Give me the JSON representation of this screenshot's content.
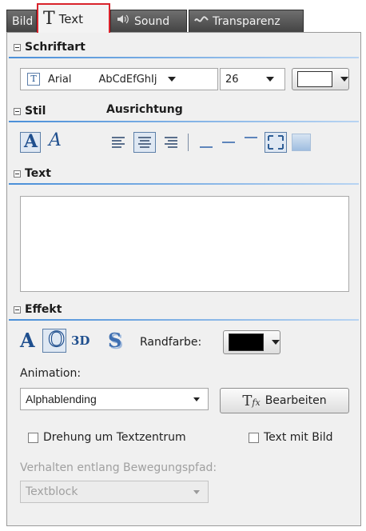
{
  "tabs": [
    {
      "label": "Bild",
      "icon": "image-icon"
    },
    {
      "label": "Text",
      "icon": "text-t-icon",
      "active": true
    },
    {
      "label": "Sound",
      "icon": "speaker-icon"
    },
    {
      "label": "Transparenz",
      "icon": "transparency-icon"
    }
  ],
  "font": {
    "section": "Schriftart",
    "name": "Arial",
    "preview": "AbCdEfGhIj",
    "size": "26",
    "color": "#ffffff"
  },
  "style": {
    "section": "Stil",
    "align_section": "Ausrichtung",
    "bold_glyph": "A",
    "italic_glyph": "A"
  },
  "text": {
    "section": "Text",
    "value": ""
  },
  "effect": {
    "section": "Effekt",
    "plain_glyph": "A",
    "outline_glyph": "O",
    "three_d_label": "3D",
    "shadow_glyph": "S",
    "border_color_label": "Randfarbe:",
    "border_color": "#000000",
    "animation_label": "Animation:",
    "animation_value": "Alphablending",
    "edit_button": "Bearbeiten",
    "rotate_label": "Drehung um Textzentrum",
    "text_with_image_label": "Text mit Bild",
    "path_label": "Verhalten entlang Bewegungspfad:",
    "path_value": "Textblock"
  }
}
